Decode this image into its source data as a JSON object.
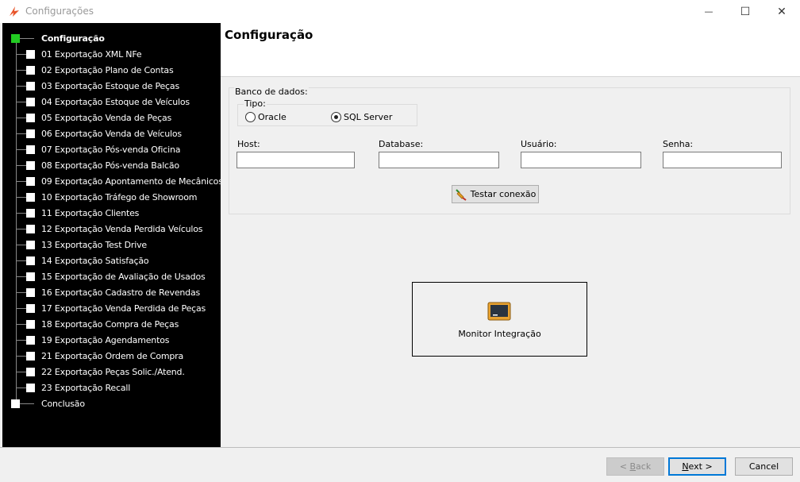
{
  "window": {
    "title": "Configurações",
    "minimize_symbol": "—",
    "maximize_symbol": "☐",
    "close_symbol": "✕"
  },
  "sidebar": {
    "root": "Configuração",
    "items": [
      "01 Exportação XML NFe",
      "02 Exportação Plano de Contas",
      "03 Exportação Estoque de Peças",
      "04 Exportação Estoque de Veículos",
      "05 Exportação Venda de Peças",
      "06 Exportação Venda de Veículos",
      "07 Exportação Pós-venda Oficina",
      "08 Exportação Pós-venda Balcão",
      "09 Exportação Apontamento de Mecânicos",
      "10 Exportação Tráfego de Showroom",
      "11 Exportação Clientes",
      "12 Exportação Venda Perdida Veículos",
      "13 Exportação Test Drive",
      "14 Exportação Satisfação",
      "15 Exportação de Avaliação de Usados",
      "16 Exportação Cadastro de Revendas",
      "17 Exportação Venda Perdida de Peças",
      "18 Exportação Compra de Peças",
      "19 Exportação Agendamentos",
      "21 Exportação Ordem de Compra",
      "22 Exportação Peças Solic./Atend.",
      "23 Exportação Recall"
    ],
    "final": "Conclusão",
    "active_color": "#22cc22"
  },
  "header": {
    "title": "Configuração"
  },
  "database": {
    "group_label": "Banco de dados:",
    "tipo_label": "Tipo:",
    "options": [
      "Oracle",
      "SQL Server"
    ],
    "selected": "SQL Server",
    "fields": {
      "host_label": "Host:",
      "host_value": "",
      "database_label": "Database:",
      "database_value": "",
      "usuario_label": "Usuário:",
      "usuario_value": "",
      "senha_label": "Senha:",
      "senha_value": ""
    },
    "test_button": "Testar conexão"
  },
  "monitor": {
    "label": "Monitor Integração",
    "icon": "monitor-icon"
  },
  "footer": {
    "back_prefix": "< ",
    "back_mnemonic": "B",
    "back_rest": "ack",
    "next_mnemonic": "N",
    "next_rest": "ext >",
    "cancel": "Cancel"
  }
}
